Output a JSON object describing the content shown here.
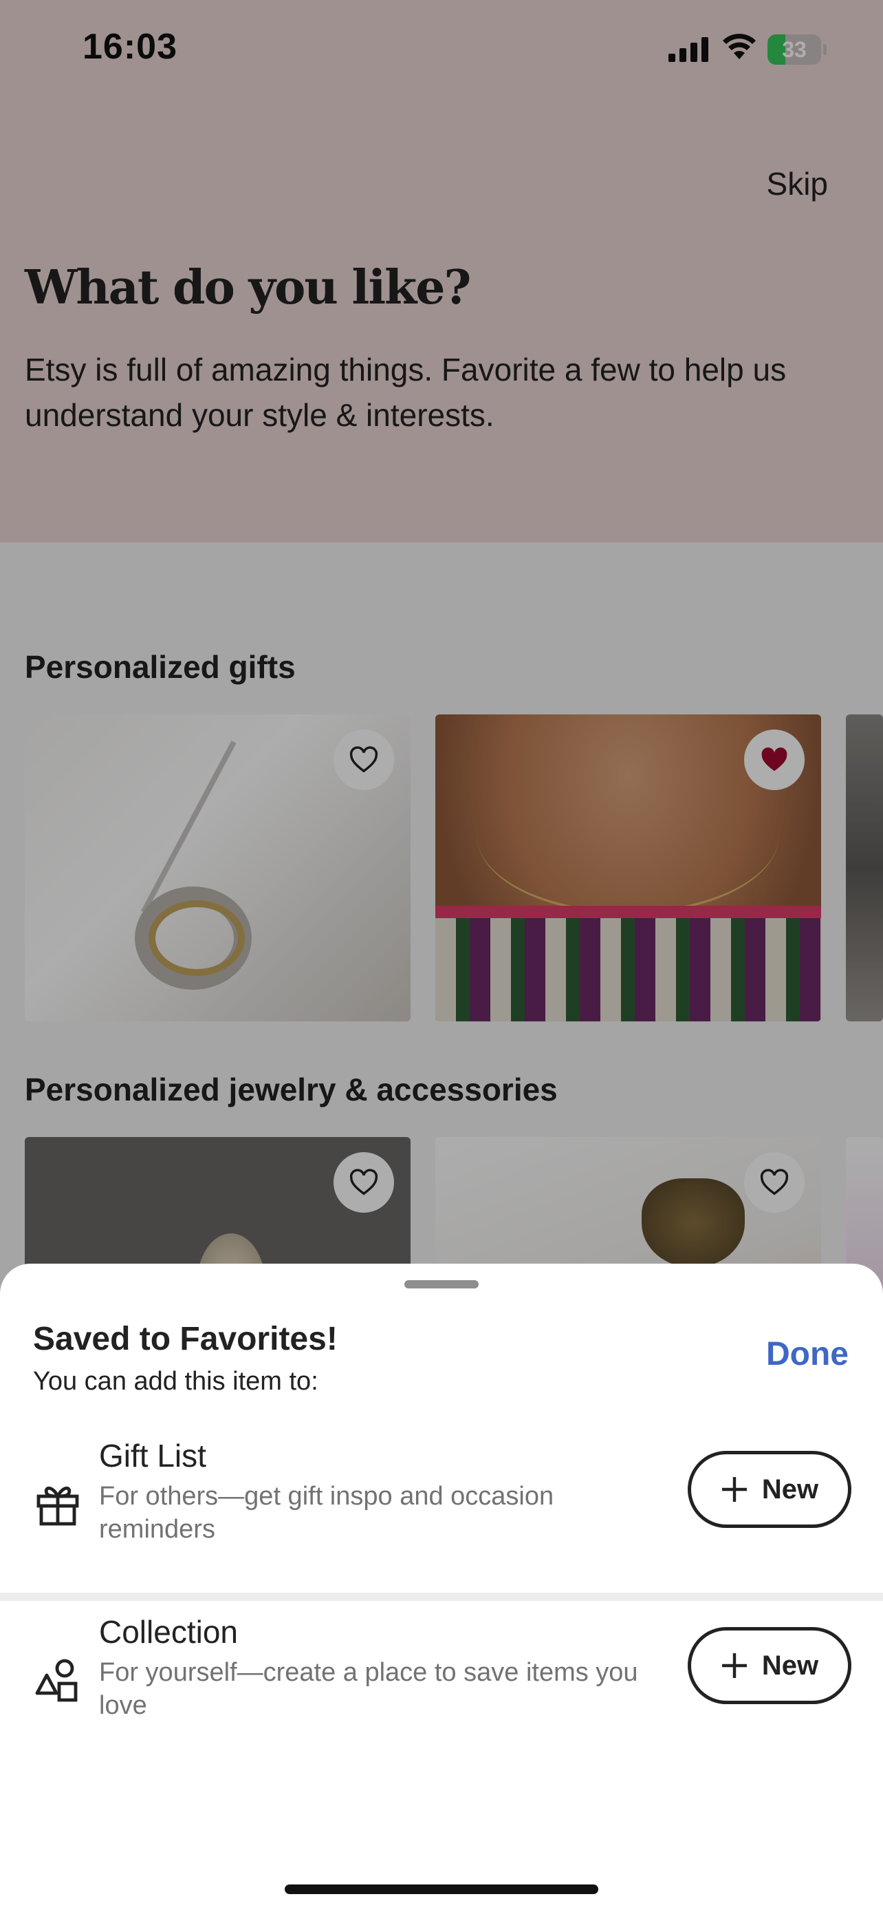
{
  "status_bar": {
    "time": "16:03",
    "battery_level": "33",
    "battery_fraction": 0.33
  },
  "header": {
    "skip_label": "Skip",
    "title": "What do you like?",
    "subtitle": "Etsy is full of amazing things. Favorite a few to help us understand your style & interests."
  },
  "sections": [
    {
      "title": "Personalized gifts",
      "items": [
        {
          "favorited": false,
          "icon": "heart-outline-icon"
        },
        {
          "favorited": true,
          "icon": "heart-filled-icon"
        },
        {
          "favorited": false,
          "icon": "heart-outline-icon"
        }
      ]
    },
    {
      "title": "Personalized jewelry & accessories",
      "items": [
        {
          "favorited": false,
          "icon": "heart-outline-icon"
        },
        {
          "favorited": false,
          "icon": "heart-outline-icon"
        },
        {
          "favorited": false,
          "icon": "heart-outline-icon"
        }
      ]
    }
  ],
  "sheet": {
    "title": "Saved to Favorites!",
    "subtitle": "You can add this item to:",
    "done_label": "Done",
    "options": [
      {
        "title": "Gift List",
        "description": "For others—get gift inspo and occasion reminders",
        "button_label": "New",
        "icon": "gift-icon"
      },
      {
        "title": "Collection",
        "description": "For yourself—create a place to save items you love",
        "button_label": "New",
        "icon": "shapes-icon"
      }
    ]
  },
  "colors": {
    "accent_blue": "#3e68c4",
    "favorite_red": "#a10a2e",
    "hero_bg": "#ead6d3"
  }
}
